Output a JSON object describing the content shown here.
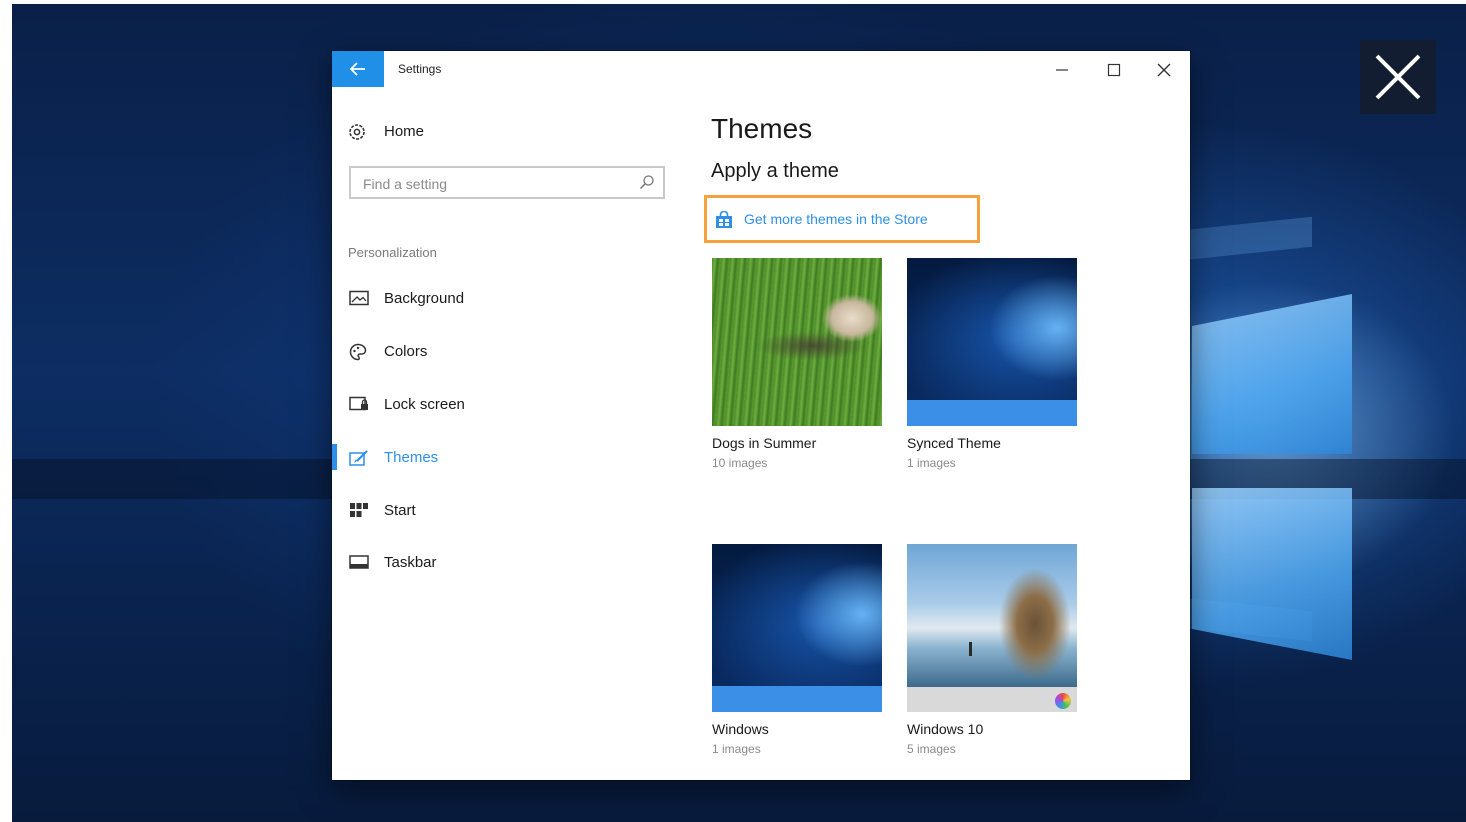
{
  "overlay": {
    "close_icon": "close-icon"
  },
  "window": {
    "title": "Settings",
    "back_icon": "back-arrow-icon",
    "controls": {
      "minimize_icon": "minimize-icon",
      "maximize_icon": "maximize-icon",
      "close_icon": "close-icon"
    }
  },
  "sidebar": {
    "home_label": "Home",
    "home_icon": "gear-icon",
    "search_placeholder": "Find a setting",
    "search_icon": "search-icon",
    "section_label": "Personalization",
    "items": [
      {
        "label": "Background",
        "icon": "picture-icon",
        "active": false
      },
      {
        "label": "Colors",
        "icon": "palette-icon",
        "active": false
      },
      {
        "label": "Lock screen",
        "icon": "lock-screen-icon",
        "active": false
      },
      {
        "label": "Themes",
        "icon": "brush-icon",
        "active": true
      },
      {
        "label": "Start",
        "icon": "start-grid-icon",
        "active": false
      },
      {
        "label": "Taskbar",
        "icon": "taskbar-icon",
        "active": false
      }
    ]
  },
  "main": {
    "title": "Themes",
    "subtitle": "Apply a theme",
    "store_link": {
      "label": "Get more themes in the Store",
      "icon": "store-bag-icon"
    },
    "themes": [
      {
        "name": "Dogs in Summer",
        "count": "10 images"
      },
      {
        "name": "Synced Theme",
        "count": "1 images"
      },
      {
        "name": "Windows",
        "count": "1 images"
      },
      {
        "name": "Windows 10",
        "count": "5 images"
      }
    ]
  },
  "colors": {
    "accent": "#2e8fe8",
    "highlight_border": "#f5a23c",
    "back_button": "#1f8fe8"
  }
}
